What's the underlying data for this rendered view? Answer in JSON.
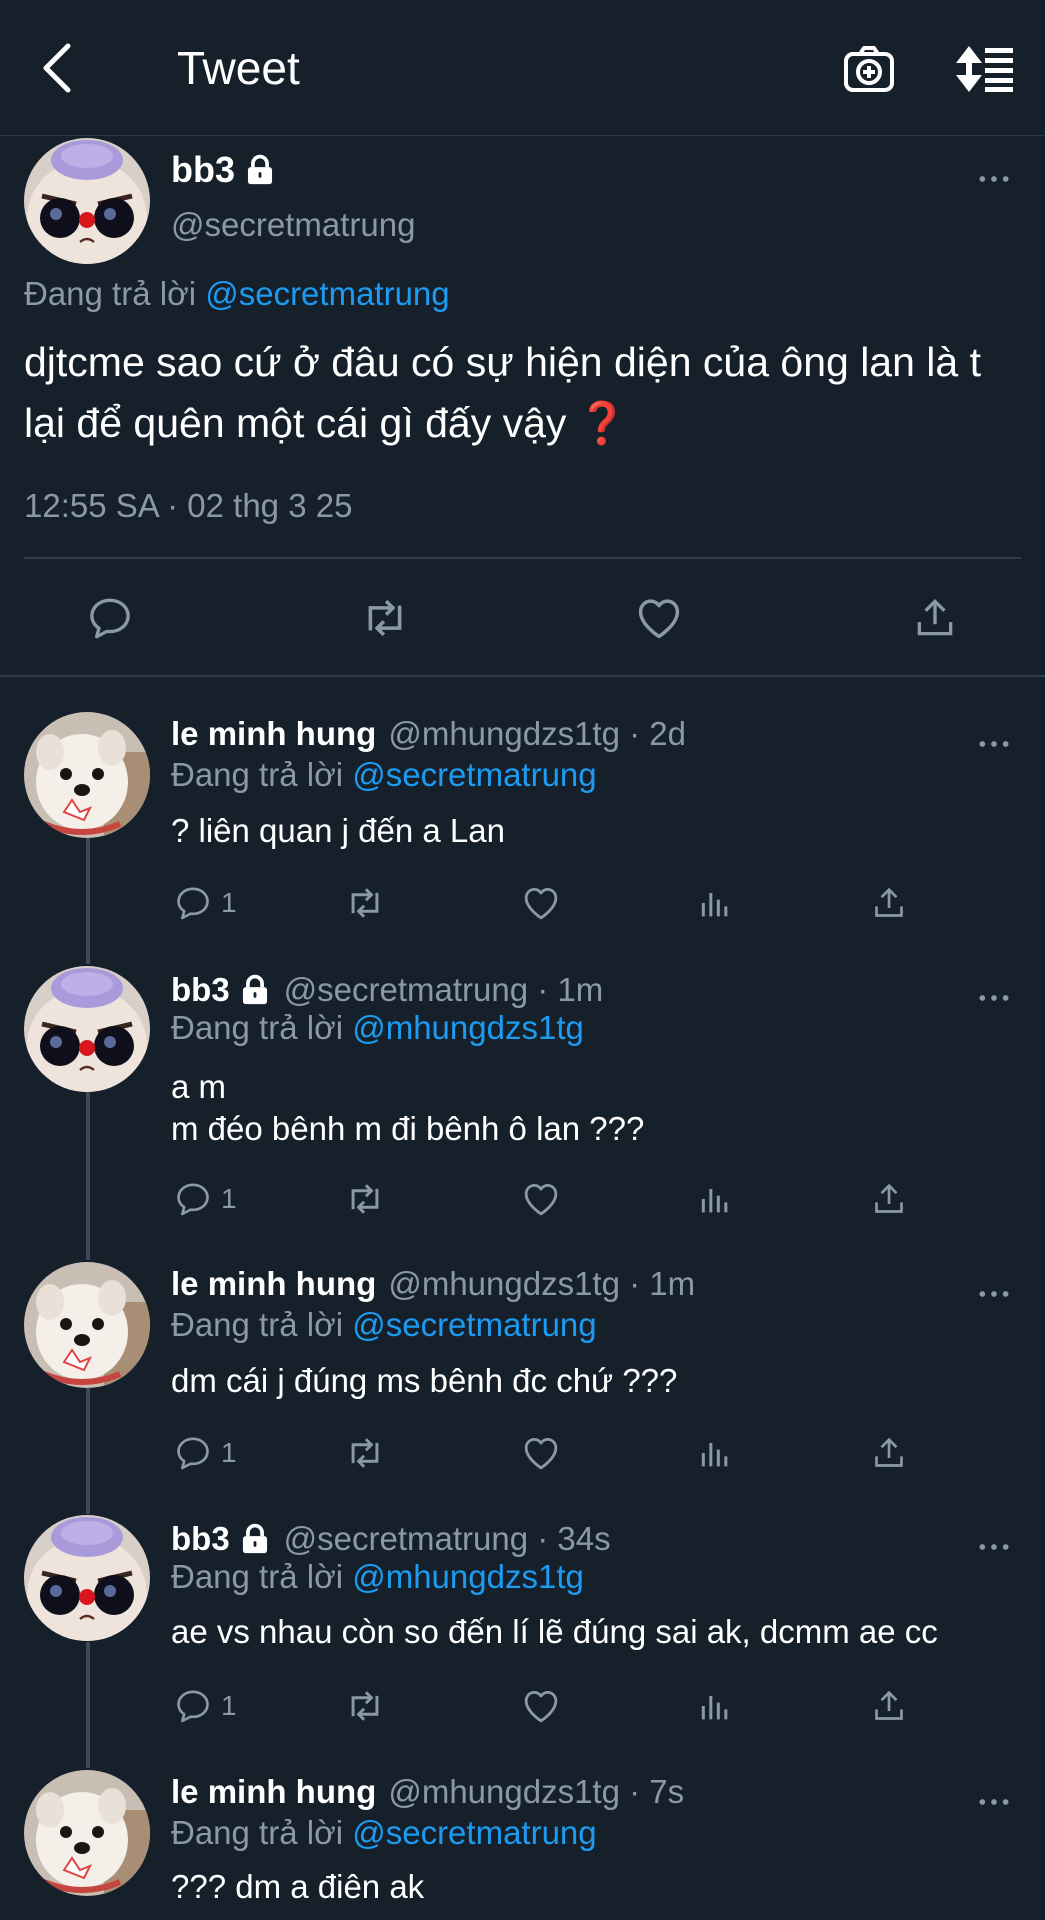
{
  "header": {
    "title": "Tweet",
    "icons": [
      "back-arrow-icon",
      "camera-plus-icon",
      "sort-icon"
    ]
  },
  "main_tweet": {
    "name": "bb3",
    "handle": "@secretmatrung",
    "replying_prefix": "Đang trả lời",
    "replying_to": "@secretmatrung",
    "text": "djtcme sao cứ ở đâu có sự hiện diện của ông lan là t lại để quên một cái gì đấy vậy",
    "emoji": "❓",
    "timestamp": "12:55 SA · 02 thg 3 25"
  },
  "replies": [
    {
      "name": "le minh hung",
      "handle": "@mhungdzs1tg · 2d",
      "locked": false,
      "replying_prefix": "Đang trả lời",
      "replying_to": "@secretmatrung",
      "text": "? liên quan j đến a Lan",
      "reply_count": "1"
    },
    {
      "name": "bb3",
      "handle": "@secretmatrung · 1m",
      "locked": true,
      "replying_prefix": "Đang trả lời",
      "replying_to": "@mhungdzs1tg",
      "text": "a m\nm đéo bênh m đi bênh ô lan ???",
      "reply_count": "1"
    },
    {
      "name": "le minh hung",
      "handle": "@mhungdzs1tg · 1m",
      "locked": false,
      "replying_prefix": "Đang trả lời",
      "replying_to": "@secretmatrung",
      "text": "dm cái j đúng ms bênh đc chứ ???",
      "reply_count": "1"
    },
    {
      "name": "bb3",
      "handle": "@secretmatrung · 34s",
      "locked": true,
      "replying_prefix": "Đang trả lời",
      "replying_to": "@mhungdzs1tg",
      "text": "ae vs nhau còn so đến lí lẽ đúng sai ak, dcmm ae cc",
      "reply_count": "1"
    },
    {
      "name": "le minh hung",
      "handle": "@mhungdzs1tg · 7s",
      "locked": false,
      "replying_prefix": "Đang trả lời",
      "replying_to": "@secretmatrung",
      "text": "??? dm a điên ak",
      "reply_count": ""
    }
  ],
  "colors": {
    "background": "#15202b",
    "text_secondary": "#8b98a5",
    "link": "#1d9bf0",
    "divider": "#2f3b47"
  }
}
